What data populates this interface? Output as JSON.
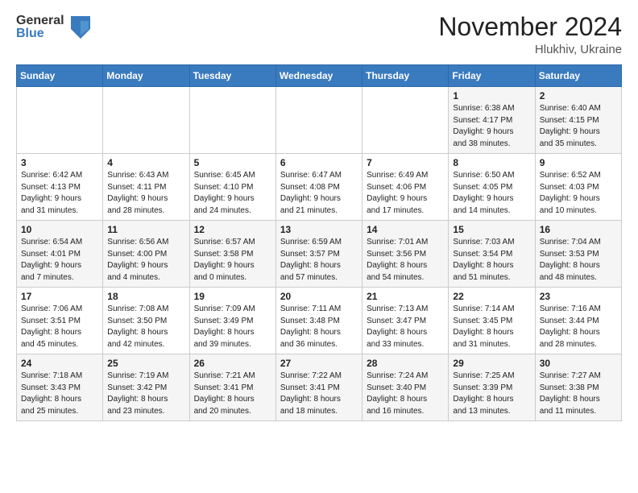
{
  "header": {
    "logo_general": "General",
    "logo_blue": "Blue",
    "title": "November 2024",
    "location": "Hlukhiv, Ukraine"
  },
  "days_of_week": [
    "Sunday",
    "Monday",
    "Tuesday",
    "Wednesday",
    "Thursday",
    "Friday",
    "Saturday"
  ],
  "weeks": [
    [
      {
        "day": "",
        "info": ""
      },
      {
        "day": "",
        "info": ""
      },
      {
        "day": "",
        "info": ""
      },
      {
        "day": "",
        "info": ""
      },
      {
        "day": "",
        "info": ""
      },
      {
        "day": "1",
        "info": "Sunrise: 6:38 AM\nSunset: 4:17 PM\nDaylight: 9 hours\nand 38 minutes."
      },
      {
        "day": "2",
        "info": "Sunrise: 6:40 AM\nSunset: 4:15 PM\nDaylight: 9 hours\nand 35 minutes."
      }
    ],
    [
      {
        "day": "3",
        "info": "Sunrise: 6:42 AM\nSunset: 4:13 PM\nDaylight: 9 hours\nand 31 minutes."
      },
      {
        "day": "4",
        "info": "Sunrise: 6:43 AM\nSunset: 4:11 PM\nDaylight: 9 hours\nand 28 minutes."
      },
      {
        "day": "5",
        "info": "Sunrise: 6:45 AM\nSunset: 4:10 PM\nDaylight: 9 hours\nand 24 minutes."
      },
      {
        "day": "6",
        "info": "Sunrise: 6:47 AM\nSunset: 4:08 PM\nDaylight: 9 hours\nand 21 minutes."
      },
      {
        "day": "7",
        "info": "Sunrise: 6:49 AM\nSunset: 4:06 PM\nDaylight: 9 hours\nand 17 minutes."
      },
      {
        "day": "8",
        "info": "Sunrise: 6:50 AM\nSunset: 4:05 PM\nDaylight: 9 hours\nand 14 minutes."
      },
      {
        "day": "9",
        "info": "Sunrise: 6:52 AM\nSunset: 4:03 PM\nDaylight: 9 hours\nand 10 minutes."
      }
    ],
    [
      {
        "day": "10",
        "info": "Sunrise: 6:54 AM\nSunset: 4:01 PM\nDaylight: 9 hours\nand 7 minutes."
      },
      {
        "day": "11",
        "info": "Sunrise: 6:56 AM\nSunset: 4:00 PM\nDaylight: 9 hours\nand 4 minutes."
      },
      {
        "day": "12",
        "info": "Sunrise: 6:57 AM\nSunset: 3:58 PM\nDaylight: 9 hours\nand 0 minutes."
      },
      {
        "day": "13",
        "info": "Sunrise: 6:59 AM\nSunset: 3:57 PM\nDaylight: 8 hours\nand 57 minutes."
      },
      {
        "day": "14",
        "info": "Sunrise: 7:01 AM\nSunset: 3:56 PM\nDaylight: 8 hours\nand 54 minutes."
      },
      {
        "day": "15",
        "info": "Sunrise: 7:03 AM\nSunset: 3:54 PM\nDaylight: 8 hours\nand 51 minutes."
      },
      {
        "day": "16",
        "info": "Sunrise: 7:04 AM\nSunset: 3:53 PM\nDaylight: 8 hours\nand 48 minutes."
      }
    ],
    [
      {
        "day": "17",
        "info": "Sunrise: 7:06 AM\nSunset: 3:51 PM\nDaylight: 8 hours\nand 45 minutes."
      },
      {
        "day": "18",
        "info": "Sunrise: 7:08 AM\nSunset: 3:50 PM\nDaylight: 8 hours\nand 42 minutes."
      },
      {
        "day": "19",
        "info": "Sunrise: 7:09 AM\nSunset: 3:49 PM\nDaylight: 8 hours\nand 39 minutes."
      },
      {
        "day": "20",
        "info": "Sunrise: 7:11 AM\nSunset: 3:48 PM\nDaylight: 8 hours\nand 36 minutes."
      },
      {
        "day": "21",
        "info": "Sunrise: 7:13 AM\nSunset: 3:47 PM\nDaylight: 8 hours\nand 33 minutes."
      },
      {
        "day": "22",
        "info": "Sunrise: 7:14 AM\nSunset: 3:45 PM\nDaylight: 8 hours\nand 31 minutes."
      },
      {
        "day": "23",
        "info": "Sunrise: 7:16 AM\nSunset: 3:44 PM\nDaylight: 8 hours\nand 28 minutes."
      }
    ],
    [
      {
        "day": "24",
        "info": "Sunrise: 7:18 AM\nSunset: 3:43 PM\nDaylight: 8 hours\nand 25 minutes."
      },
      {
        "day": "25",
        "info": "Sunrise: 7:19 AM\nSunset: 3:42 PM\nDaylight: 8 hours\nand 23 minutes."
      },
      {
        "day": "26",
        "info": "Sunrise: 7:21 AM\nSunset: 3:41 PM\nDaylight: 8 hours\nand 20 minutes."
      },
      {
        "day": "27",
        "info": "Sunrise: 7:22 AM\nSunset: 3:41 PM\nDaylight: 8 hours\nand 18 minutes."
      },
      {
        "day": "28",
        "info": "Sunrise: 7:24 AM\nSunset: 3:40 PM\nDaylight: 8 hours\nand 16 minutes."
      },
      {
        "day": "29",
        "info": "Sunrise: 7:25 AM\nSunset: 3:39 PM\nDaylight: 8 hours\nand 13 minutes."
      },
      {
        "day": "30",
        "info": "Sunrise: 7:27 AM\nSunset: 3:38 PM\nDaylight: 8 hours\nand 11 minutes."
      }
    ]
  ]
}
